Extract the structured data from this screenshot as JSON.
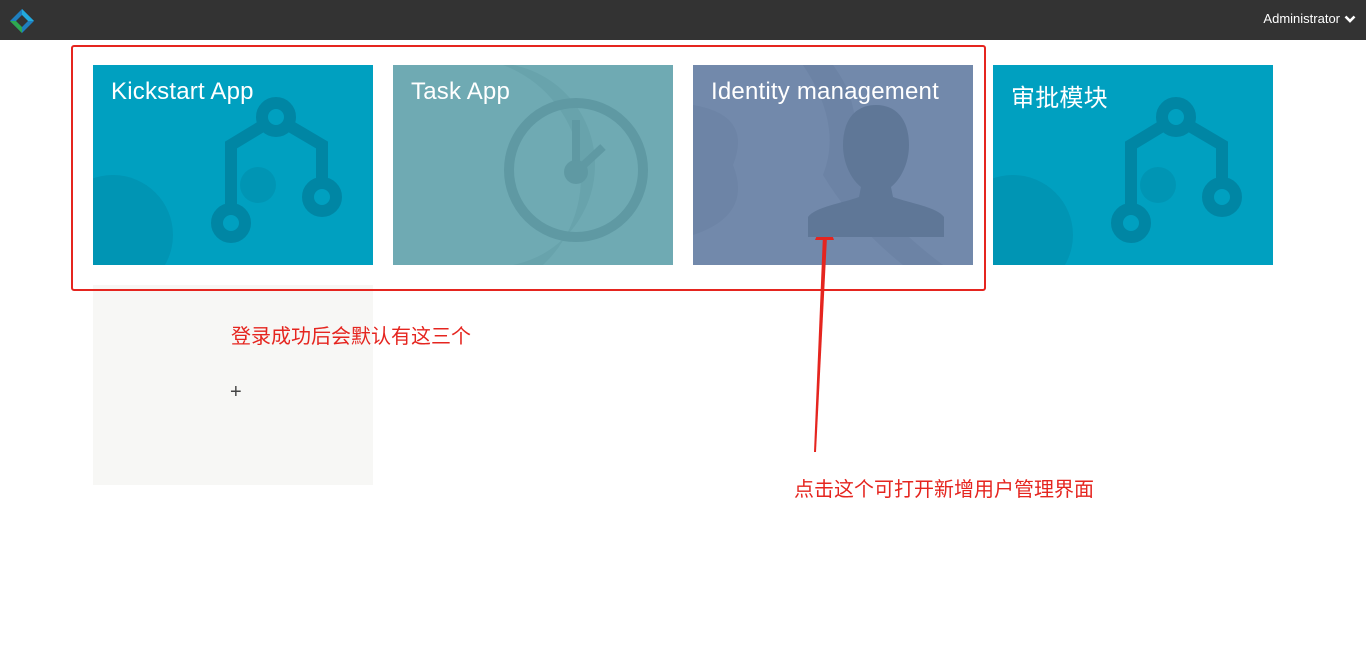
{
  "header": {
    "logo_icon": "diamond-logo-icon",
    "user_label": "Administrator",
    "user_menu_icon": "chevron-down-icon",
    "background": "#333333"
  },
  "tiles": [
    {
      "title": "Kickstart App",
      "icon": "branch-flow-icon",
      "color": "#00a0c0"
    },
    {
      "title": "Task App",
      "icon": "clock-icon",
      "color": "#6faab3"
    },
    {
      "title": "Identity management",
      "icon": "user-silhouette-icon",
      "color": "#7289ab"
    },
    {
      "title": "审批模块",
      "icon": "branch-flow-icon",
      "color": "#00a0c0"
    }
  ],
  "add_tile": {
    "plus_label": "+"
  },
  "annotations": {
    "default_apps_note": "登录成功后会默认有这三个",
    "identity_note": "点击这个可打开新增用户管理界面",
    "color": "#e5251f"
  }
}
